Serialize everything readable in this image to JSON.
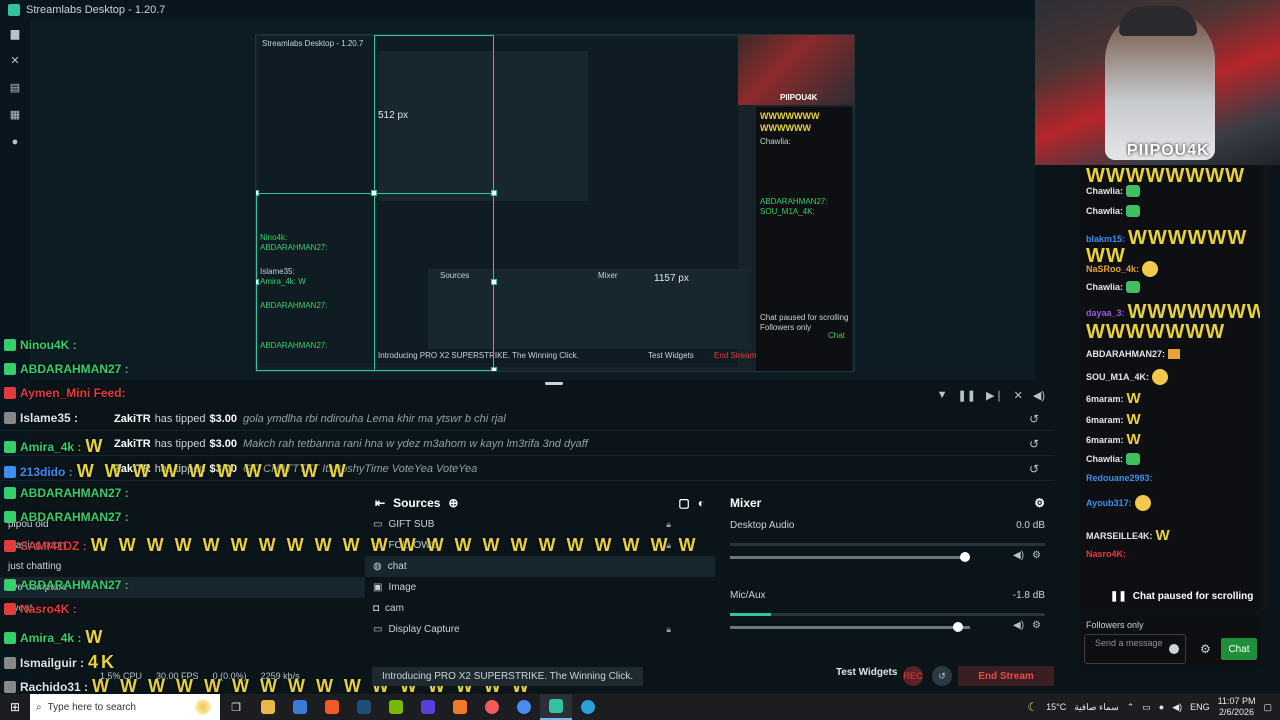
{
  "window": {
    "title": "Streamlabs Desktop - 1.20.7"
  },
  "leftnav": [
    {
      "icon": "editor-icon",
      "glyph": "▆"
    },
    {
      "icon": "tools-icon",
      "glyph": "✕"
    },
    {
      "icon": "store-icon",
      "glyph": "▤"
    },
    {
      "icon": "widgets-icon",
      "glyph": "▦"
    },
    {
      "icon": "recording-icon",
      "glyph": "●"
    }
  ],
  "preview": {
    "width_label": "1157 px",
    "height_label": "512 px",
    "inner_title": "Streamlabs Desktop - 1.20.7",
    "inner_sources": "Sources",
    "inner_mixer": "Mixer",
    "inner_test": "Test Widgets",
    "inner_end": "End Stream",
    "inner_paused": "Chat paused for scrolling",
    "inner_followers": "Followers only",
    "inner_chat": "Chat",
    "inner_promo": "Introducing PRO X2 SUPERSTRIKE. The Winning Click.",
    "inner_lines": [
      "Nino4k: ",
      "ABDARAHMAN27:",
      "Islame35:",
      "Amira_4k: W",
      "ABDARAHMAN27:",
      "ABDARAHMAN27:"
    ],
    "mini_cam_tag": "PIIPOU4K",
    "mini_chat_lines": [
      "WWWWWWW",
      "WWWWWW",
      "Chawlia:",
      "ABDARAHMAN27:",
      "SOU_M1A_4K:"
    ]
  },
  "overlay_chat": [
    {
      "name": "Ninou4K :",
      "color": "green",
      "text": ""
    },
    {
      "name": "ABDARAHMAN27 :",
      "color": "green",
      "text": ""
    },
    {
      "name": "Aymen_Mini Feed:",
      "color": "red",
      "text": ""
    },
    {
      "name": "Islame35 :",
      "color": "white",
      "text": ""
    },
    {
      "name": "Amira_4k :",
      "color": "green",
      "text": "W"
    },
    {
      "name": "213dido :",
      "color": "blue",
      "text": "W W W W W W W W W W"
    },
    {
      "name": "ABDARAHMAN27 :",
      "color": "green",
      "text": ""
    },
    {
      "name": "ABDARAHMAN27 :",
      "color": "green",
      "text": ""
    },
    {
      "name": "SAMI41DZ :",
      "color": "red",
      "text": "W W W W W W W W W W W W W W W W W W W W W W"
    },
    {
      "name": "ABDARAHMAN27 :",
      "color": "green",
      "text": ""
    },
    {
      "name": "Nasro4K :",
      "color": "red",
      "text": ""
    },
    {
      "name": "Amira_4k :",
      "color": "green",
      "text": "W"
    },
    {
      "name": "Ismailguir :",
      "color": "white",
      "text": "4K"
    },
    {
      "name": "Rachido31 :",
      "color": "white",
      "text": "W W W W W W W W W W W W W W W W"
    }
  ],
  "events": [
    {
      "name": "ZakiTR",
      "action": "has tipped",
      "amount": "$3.00",
      "message": "gola ymdlha rbi ndirouha Lema khir ma ytswr b chi rjal"
    },
    {
      "name": "ZakiTR",
      "action": "has tipped",
      "amount": "$3.00",
      "message": "Makch rah tetbanna rani hna w ydez m3ahom w kayn lm3rifa 3nd dyaff"
    },
    {
      "name": "ZakiTR",
      "action": "has tipped",
      "amount": "$3.00",
      "message": "GO CHATTTTT ItsBoshyTime VoteYea VoteYea"
    }
  ],
  "scenes": {
    "items": [
      "pipou old",
      "starting soon",
      "just chatting",
      "live campture",
      "event"
    ]
  },
  "sources": {
    "title": "Sources",
    "items": [
      "GIFT SUB",
      "FOLLOWS",
      "chat",
      "Image",
      "cam",
      "Display Capture"
    ]
  },
  "mixer": {
    "title": "Mixer",
    "channels": [
      {
        "name": "Desktop Audio",
        "db": "0.0 dB",
        "level": 0.0,
        "fader": 1.0
      },
      {
        "name": "Mic/Aux",
        "db": "-1.8 dB",
        "level": 0.13,
        "fader": 0.97
      }
    ]
  },
  "footer": {
    "cpu": "1.5% CPU",
    "fps": "30.00 FPS",
    "dropped": "0 (0.0%)",
    "bitrate": "2259 kb/s",
    "promo": "Introducing PRO X2 SUPERSTRIKE. The Winning Click.",
    "test_widgets": "Test Widgets",
    "end_stream": "End Stream"
  },
  "webcam": {
    "tag": "PIIPOU4K"
  },
  "twitch_chat": {
    "lines": [
      {
        "name": "",
        "text": "WWWWWWWW",
        "kind": "wbig",
        "color": "#e8d23a"
      },
      {
        "name": "Chawlia:",
        "text": "",
        "kind": "emote",
        "color": "#e6e6e6"
      },
      {
        "name": "Chawlia:",
        "text": "",
        "kind": "emote",
        "color": "#e6e6e6"
      },
      {
        "name": "blakm15:",
        "text": "WWWWWW",
        "kind": "wbig",
        "color": "#3c8ff0"
      },
      {
        "name": "",
        "text": "WW",
        "kind": "wbig",
        "color": "#e8d23a"
      },
      {
        "name": "NaSRoo_4k:",
        "text": "",
        "kind": "smile",
        "color": "#e8a23a"
      },
      {
        "name": "Chawlia:",
        "text": "",
        "kind": "emote",
        "color": "#e6e6e6"
      },
      {
        "name": "dayaa_3:",
        "text": "WWWWWWW",
        "kind": "wbig",
        "color": "#9a5ad8"
      },
      {
        "name": "",
        "text": "WWWWWWW",
        "kind": "wbig",
        "color": "#e8d23a"
      },
      {
        "name": "ABDARAHMAN27:",
        "text": "",
        "kind": "crown",
        "color": "#e6e6e6"
      },
      {
        "name": "SOU_M1A_4K:",
        "text": "",
        "kind": "smile",
        "color": "#e6e6e6"
      },
      {
        "name": "6maram:",
        "text": "W",
        "kind": "wmid",
        "color": "#e6e6e6"
      },
      {
        "name": "6maram:",
        "text": "W",
        "kind": "wmid",
        "color": "#e6e6e6"
      },
      {
        "name": "6maram:",
        "text": "W",
        "kind": "wmid",
        "color": "#e6e6e6"
      },
      {
        "name": "Chawlia:",
        "text": "",
        "kind": "emote",
        "color": "#e6e6e6"
      },
      {
        "name": "Redouane2993:",
        "text": "",
        "kind": "none",
        "color": "#3c8ff0"
      },
      {
        "name": "Ayoub317:",
        "text": "",
        "kind": "smile",
        "color": "#3c8ff0"
      },
      {
        "name": "MARSEILLE4K:",
        "text": "W",
        "kind": "wmid",
        "color": "#e6e6e6"
      },
      {
        "name": "Nasro4K:",
        "text": "",
        "kind": "none",
        "color": "#e23b3b"
      }
    ],
    "paused": "Chat paused for scrolling",
    "followers": "Followers only",
    "placeholder": "Send a message",
    "send": "Chat"
  },
  "taskbar": {
    "search": "Type here to search",
    "weather": "15°C",
    "weather_desc": "سماء صافية",
    "lang": "ENG",
    "time": "11:07 PM",
    "date": "2/6/2026"
  }
}
